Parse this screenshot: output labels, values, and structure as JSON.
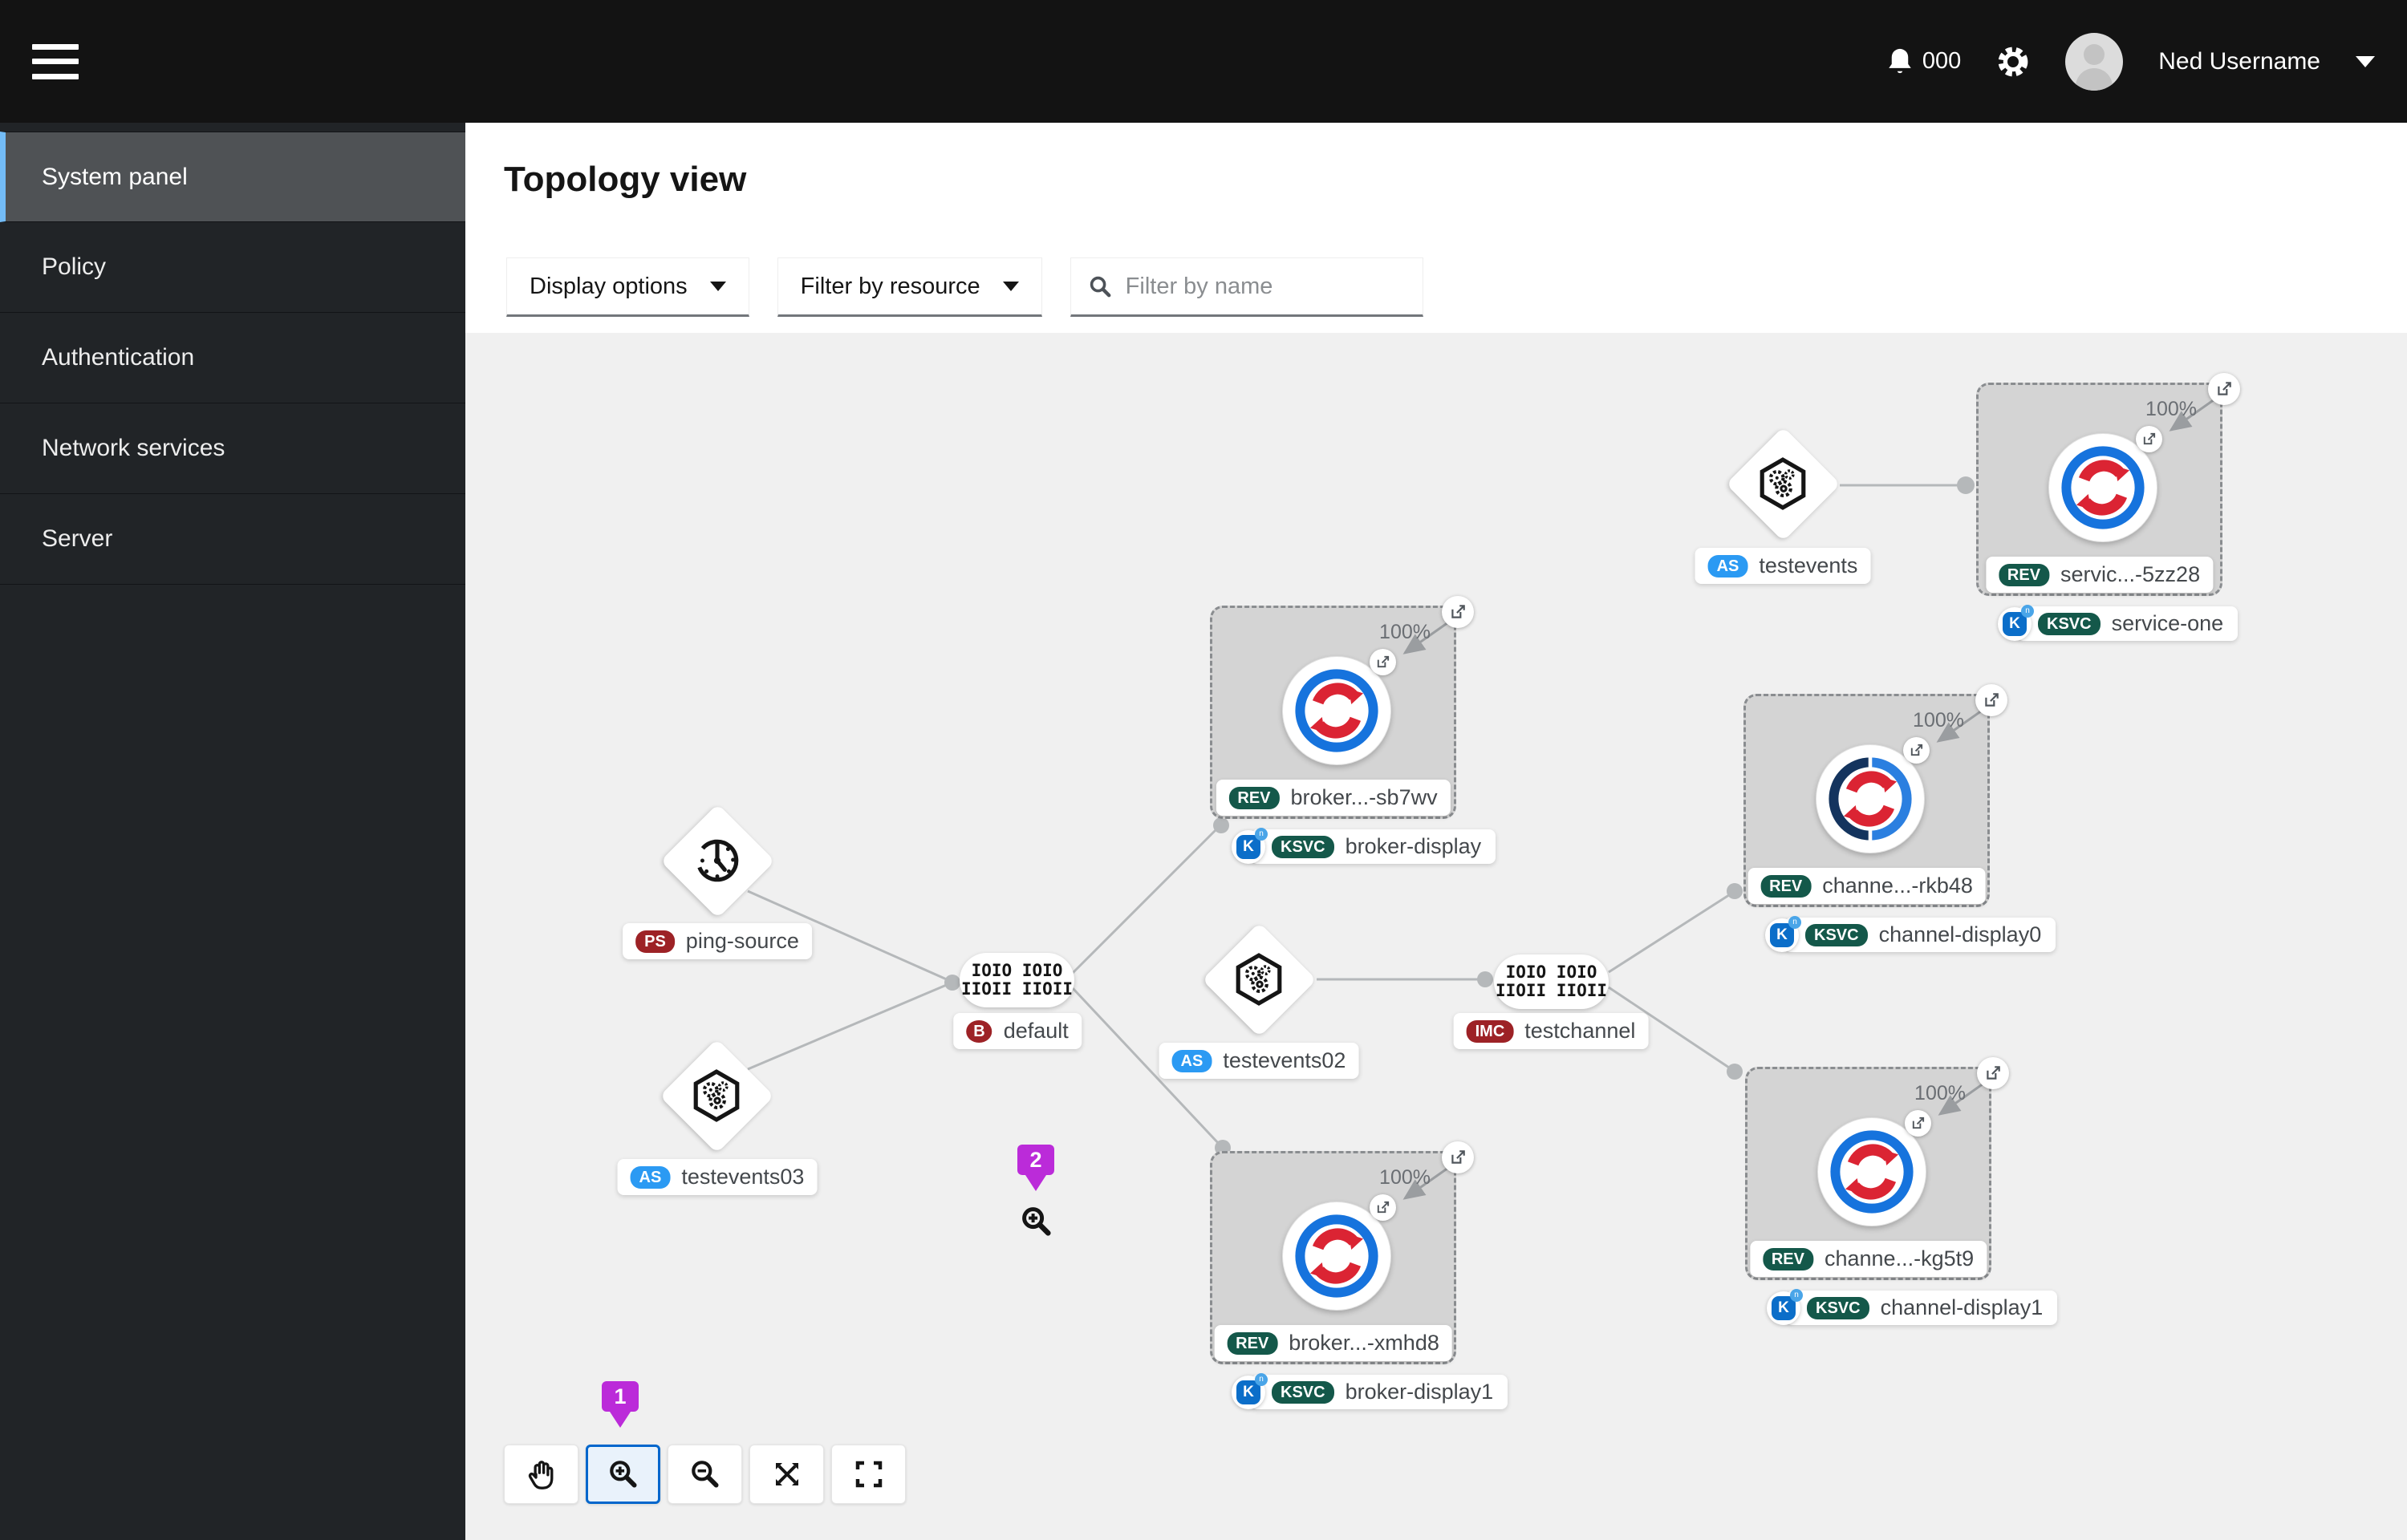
{
  "colors": {
    "header_bg": "#131313",
    "sidebar_bg": "#212427",
    "sidebar_selected_accent": "#73bcf7",
    "canvas_bg": "#f0f0f0",
    "group_fill": "#d4d4d4",
    "edge_gray": "#b5b8ba",
    "badge_blue": "#2b9af3",
    "badge_red": "#9d2226",
    "badge_green": "#14584a",
    "logo_blue": "#1673dd",
    "logo_red": "#db2433",
    "ring_navy": "#14345e",
    "ring_lightblue": "#2b7fe0",
    "marker_purple": "#bb2bd9",
    "selected_button_border": "#0066cc"
  },
  "header": {
    "notification_count": "000",
    "username": "Ned Username"
  },
  "sidebar": {
    "items": [
      {
        "label": "System panel"
      },
      {
        "label": "Policy"
      },
      {
        "label": "Authentication"
      },
      {
        "label": "Network services"
      },
      {
        "label": "Server"
      }
    ]
  },
  "page": {
    "title": "Topology view"
  },
  "filters": {
    "display_options": "Display options",
    "filter_by_resource": "Filter by resource",
    "search_placeholder": "Filter by name"
  },
  "topology": {
    "binary_icon": {
      "line1": "IOIO IOIO",
      "line2": "IIOII IIOII"
    },
    "knative": {
      "letter": "K",
      "mini": "n"
    },
    "groups": [
      {
        "traffic": "100%",
        "rev_badge": "REV",
        "rev_label": "servic...-5zz28",
        "ksvc_badge": "KSVC",
        "ksvc_label": "service-one"
      },
      {
        "traffic": "100%",
        "rev_badge": "REV",
        "rev_label": "broker...-sb7wv",
        "ksvc_badge": "KSVC",
        "ksvc_label": "broker-display"
      },
      {
        "traffic": "100%",
        "rev_badge": "REV",
        "rev_label": "channe...-rkb48",
        "ksvc_badge": "KSVC",
        "ksvc_label": "channel-display0"
      },
      {
        "traffic": "100%",
        "rev_badge": "REV",
        "rev_label": "broker...-xmhd8",
        "ksvc_badge": "KSVC",
        "ksvc_label": "broker-display1"
      },
      {
        "traffic": "100%",
        "rev_badge": "REV",
        "rev_label": "channe...-kg5t9",
        "ksvc_badge": "KSVC",
        "ksvc_label": "channel-display1"
      }
    ],
    "sources": [
      {
        "badge": "AS",
        "label": "testevents"
      },
      {
        "badge": "PS",
        "label": "ping-source"
      },
      {
        "badge": "AS",
        "label": "testevents02"
      },
      {
        "badge": "AS",
        "label": "testevents03"
      }
    ],
    "broker": {
      "badge": "B",
      "label": "default"
    },
    "channel": {
      "badge": "IMC",
      "label": "testchannel"
    },
    "markers": [
      {
        "label": "1"
      },
      {
        "label": "2"
      }
    ]
  }
}
